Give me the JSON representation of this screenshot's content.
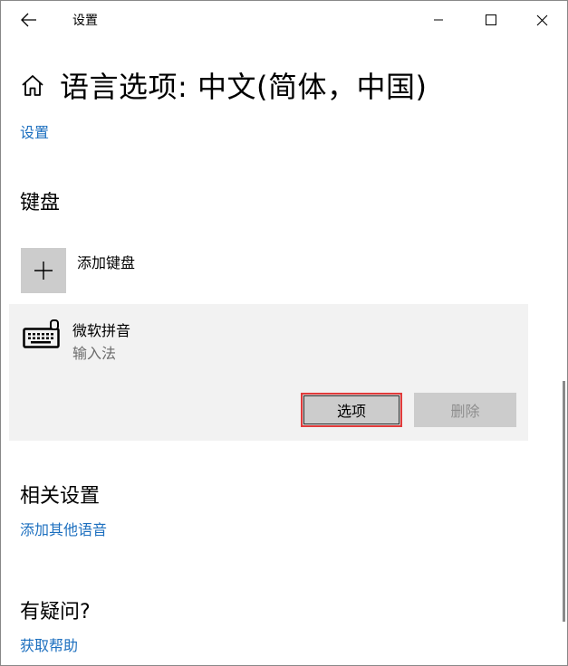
{
  "window": {
    "title": "设置",
    "controls": {
      "minimize_icon": "minimize-icon",
      "maximize_icon": "maximize-icon",
      "close_icon": "close-icon"
    }
  },
  "header": {
    "page_title": "语言选项: 中文(简体，中国)",
    "breadcrumb": "设置"
  },
  "keyboard_section": {
    "heading": "键盘",
    "add_label": "添加键盘",
    "items": [
      {
        "name": "微软拼音",
        "type": "输入法",
        "options_label": "选项",
        "delete_label": "删除"
      }
    ]
  },
  "related": {
    "heading": "相关设置",
    "link": "添加其他语音"
  },
  "question": {
    "heading": "有疑问?",
    "link": "获取帮助"
  },
  "colors": {
    "link": "#1c6fbf",
    "highlight": "#e23b3b",
    "tile": "#cccccc",
    "item_bg": "#f2f2f2"
  }
}
